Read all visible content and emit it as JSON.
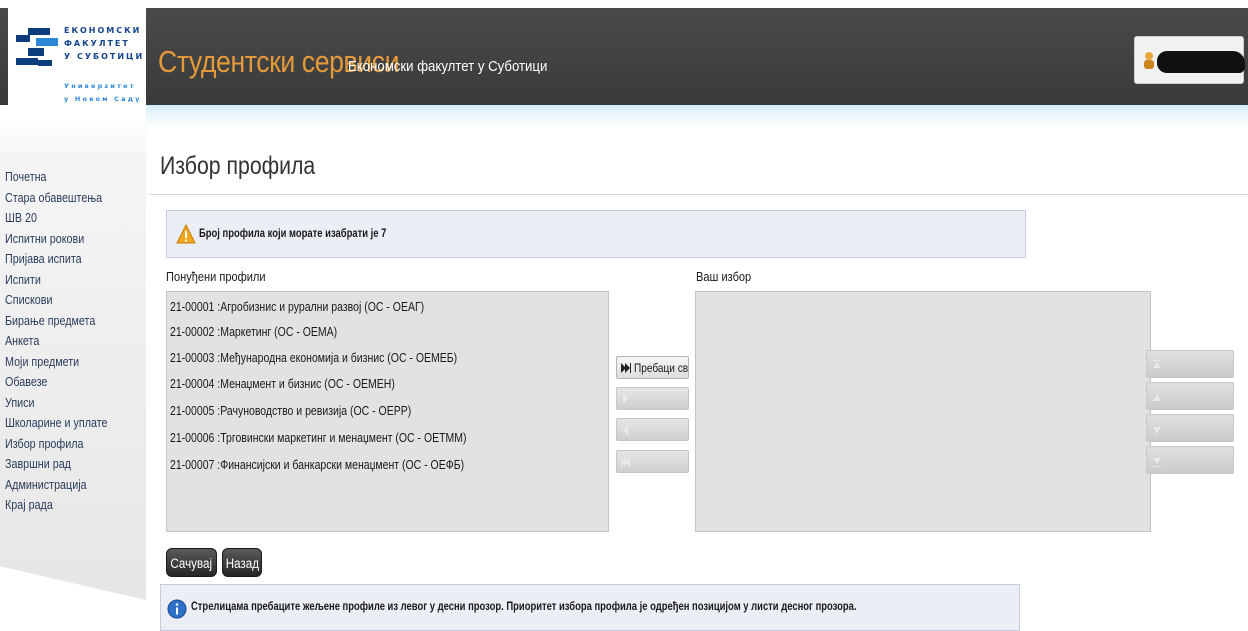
{
  "header": {
    "logo": {
      "lines": [
        "ЕКОНОМСКИ",
        "ФАКУЛТЕТ",
        "У СУБОТИЦИ"
      ],
      "sub_lines": [
        "Универзитет",
        "у Новом Саду"
      ]
    },
    "title": "Студентски сервиси",
    "subtitle": "Економски факултет у Суботици"
  },
  "sidebar": {
    "items": [
      {
        "label": "Почетна"
      },
      {
        "label": "Стара обавештења"
      },
      {
        "label": "ШВ 20"
      },
      {
        "label": "Испитни рокови"
      },
      {
        "label": "Пријава испита"
      },
      {
        "label": "Испити"
      },
      {
        "label": "Спискови"
      },
      {
        "label": "Бирање предмета"
      },
      {
        "label": "Анкета"
      },
      {
        "label": "Моји предмети"
      },
      {
        "label": "Обавезе"
      },
      {
        "label": "Уписи"
      },
      {
        "label": "Школарине и уплате"
      },
      {
        "label": "Избор профила"
      },
      {
        "label": "Завршни рад"
      },
      {
        "label": "Администрација"
      },
      {
        "label": "Крај рада"
      }
    ]
  },
  "page": {
    "title": "Избор профила",
    "warning": "Број профила који морате изабрати је 7",
    "offered_label": "Понуђени профили",
    "chosen_label": "Ваш избор",
    "offered_profiles": [
      "21-00001 :Агробизнис и рурални развој (ОС - ОЕАГ)",
      "21-00002 :Маркетинг (ОС - ОЕМА)",
      "21-00003 :Међународна економија и бизнис (ОС - ОЕМЕБ)",
      "21-00004 :Менаџмент и бизнис (ОС - ОЕМЕН)",
      "21-00005 :Рачуноводство и ревизија (ОС - ОЕРР)",
      "21-00006 :Трговински маркетинг и менаџмент (ОС - ОЕТММ)",
      "21-00007 :Финансијски и банкарски менаџмент (ОС - ОЕФБ)"
    ],
    "chosen_profiles": [],
    "move_buttons": {
      "move_all": "Пребаци све"
    },
    "actions": {
      "save": "Сачувај",
      "back": "Назад"
    },
    "info": "Стрелицама пребаците жељене профиле из левог у десни прозор. Приоритет избора профила је одређен позицијом у листи десног прозора."
  },
  "colors": {
    "header_bg": "#404040",
    "title_accent": "#e49a3a",
    "logo_blue": "#0d3d7a",
    "msg_box_bg": "#eceef6",
    "list_bg": "#e2e2e2"
  }
}
